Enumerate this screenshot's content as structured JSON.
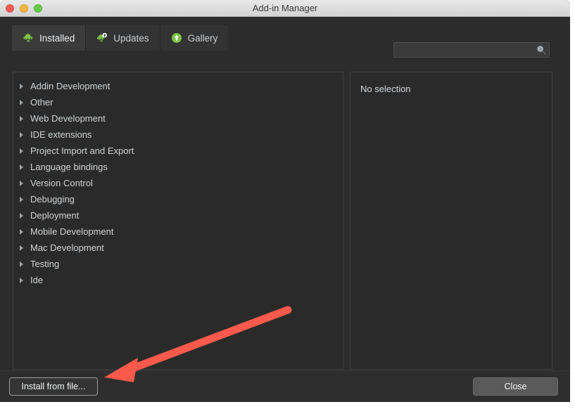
{
  "window": {
    "title": "Add-in Manager",
    "traffic_lights": [
      {
        "name": "close",
        "color": "#f25c54"
      },
      {
        "name": "minimize",
        "color": "#f5b83d"
      },
      {
        "name": "zoom",
        "color": "#66cc49"
      }
    ]
  },
  "tabs": [
    {
      "label": "Installed",
      "icon": "puzzle-piece-icon",
      "active": true
    },
    {
      "label": "Updates",
      "icon": "puzzle-piece-update-icon",
      "active": false
    },
    {
      "label": "Gallery",
      "icon": "upload-circle-icon",
      "active": false
    }
  ],
  "search": {
    "value": "",
    "placeholder": "",
    "icon": "search-icon"
  },
  "categories": [
    {
      "label": "Addin Development"
    },
    {
      "label": "Other"
    },
    {
      "label": "Web Development"
    },
    {
      "label": "IDE extensions"
    },
    {
      "label": "Project Import and Export"
    },
    {
      "label": "Language bindings"
    },
    {
      "label": "Version Control"
    },
    {
      "label": "Debugging"
    },
    {
      "label": "Deployment"
    },
    {
      "label": "Mobile Development"
    },
    {
      "label": "Mac Development"
    },
    {
      "label": "Testing"
    },
    {
      "label": "Ide"
    }
  ],
  "details": {
    "empty_text": "No selection"
  },
  "footer": {
    "install_label": "Install from file...",
    "close_label": "Close"
  },
  "annotation": {
    "type": "arrow",
    "color": "#fa5a4b",
    "points_to": "Install from file... button"
  },
  "colors": {
    "window_background": "#2c2c2c",
    "panel_background": "#2a2a2a",
    "tab_active": "#3b3b3b",
    "tab_inactive": "#333333",
    "accent_green": "#7ac143",
    "annotation_red": "#fa5a4b"
  }
}
